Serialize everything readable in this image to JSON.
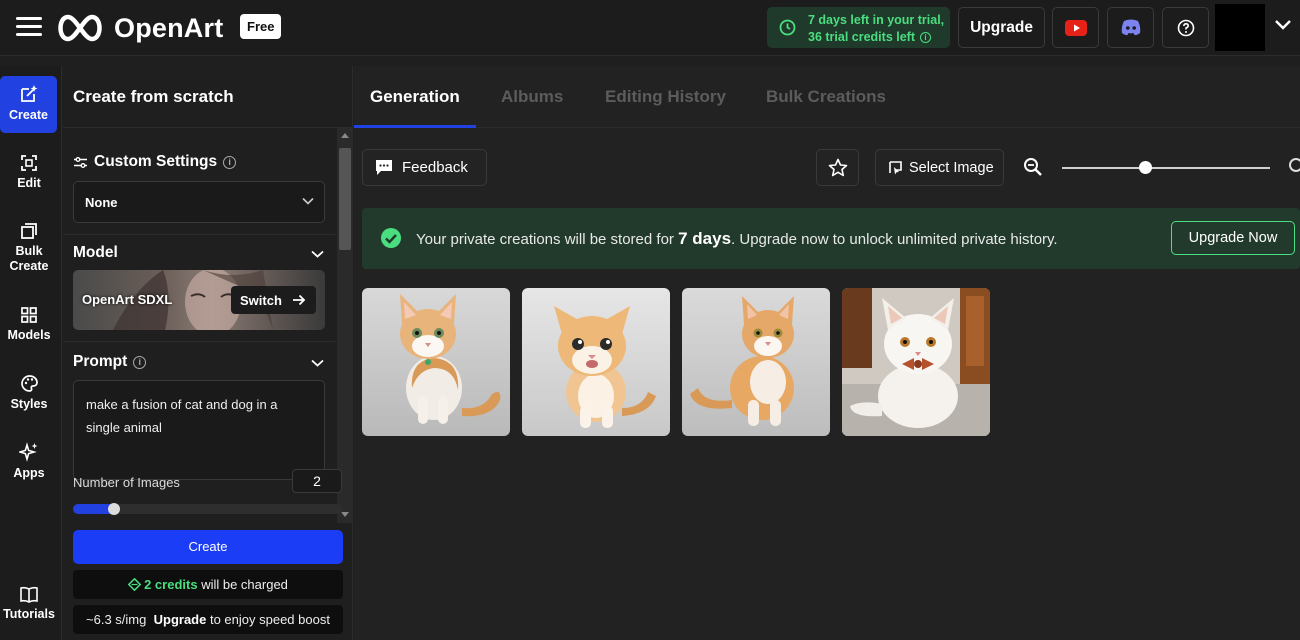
{
  "app": {
    "logo_text": "OpenArt",
    "plan_badge": "Free"
  },
  "header": {
    "trial_line1": "7 days left in your trial,",
    "trial_line2": "36 trial credits left",
    "upgrade_label": "Upgrade",
    "icons": [
      "menu-icon",
      "clock-icon",
      "info-icon",
      "youtube-icon",
      "discord-icon",
      "help-icon",
      "chevron-down-icon"
    ]
  },
  "leftnav": {
    "items": [
      {
        "label": "Create",
        "icon": "create-icon",
        "active": true
      },
      {
        "label": "Edit",
        "icon": "edit-icon"
      },
      {
        "label": "Bulk Create",
        "icon": "bulk-create-icon"
      },
      {
        "label": "Models",
        "icon": "models-icon"
      },
      {
        "label": "Styles",
        "icon": "palette-icon"
      },
      {
        "label": "Apps",
        "icon": "sparkle-icon"
      },
      {
        "label": "Tutorials",
        "icon": "book-icon"
      }
    ]
  },
  "panel": {
    "title": "Create from scratch",
    "custom_settings": {
      "label": "Custom Settings",
      "selected": "None"
    },
    "model": {
      "label": "Model",
      "name": "OpenArt SDXL",
      "switch_label": "Switch"
    },
    "prompt": {
      "label": "Prompt",
      "value": "make a fusion of cat and dog in a single animal"
    },
    "number_of_images": {
      "label": "Number of Images",
      "value": "2",
      "slider_fraction": 0.14
    },
    "create_label": "Create",
    "credits": {
      "amount": "2 credits",
      "suffix": "will be charged"
    },
    "speed": {
      "rate": "~6.3 s/img",
      "upgrade": "Upgrade",
      "suffix": "to enjoy speed boost"
    }
  },
  "main": {
    "tabs": [
      {
        "label": "Generation",
        "active": true
      },
      {
        "label": "Albums"
      },
      {
        "label": "Editing History"
      },
      {
        "label": "Bulk Creations"
      }
    ],
    "toolbar": {
      "feedback_label": "Feedback",
      "select_image_label": "Select Image",
      "zoom_fraction": 0.4
    },
    "banner": {
      "text_before": "Your private creations will be stored for",
      "highlight": "7 days",
      "text_after": ". Upgrade now to unlock unlimited private history.",
      "button_label": "Upgrade Now"
    },
    "images": [
      {
        "subject": "orange-white kitten sitting, grey background"
      },
      {
        "subject": "fluffy orange kitten, open mouth"
      },
      {
        "subject": "orange tabby cat sitting, white chest"
      },
      {
        "subject": "white fluffy cat with bow tie, indoor"
      }
    ]
  },
  "colors": {
    "accent_blue": "#2141e0",
    "success_green": "#4ade80",
    "banner_bg": "#223a2b"
  }
}
